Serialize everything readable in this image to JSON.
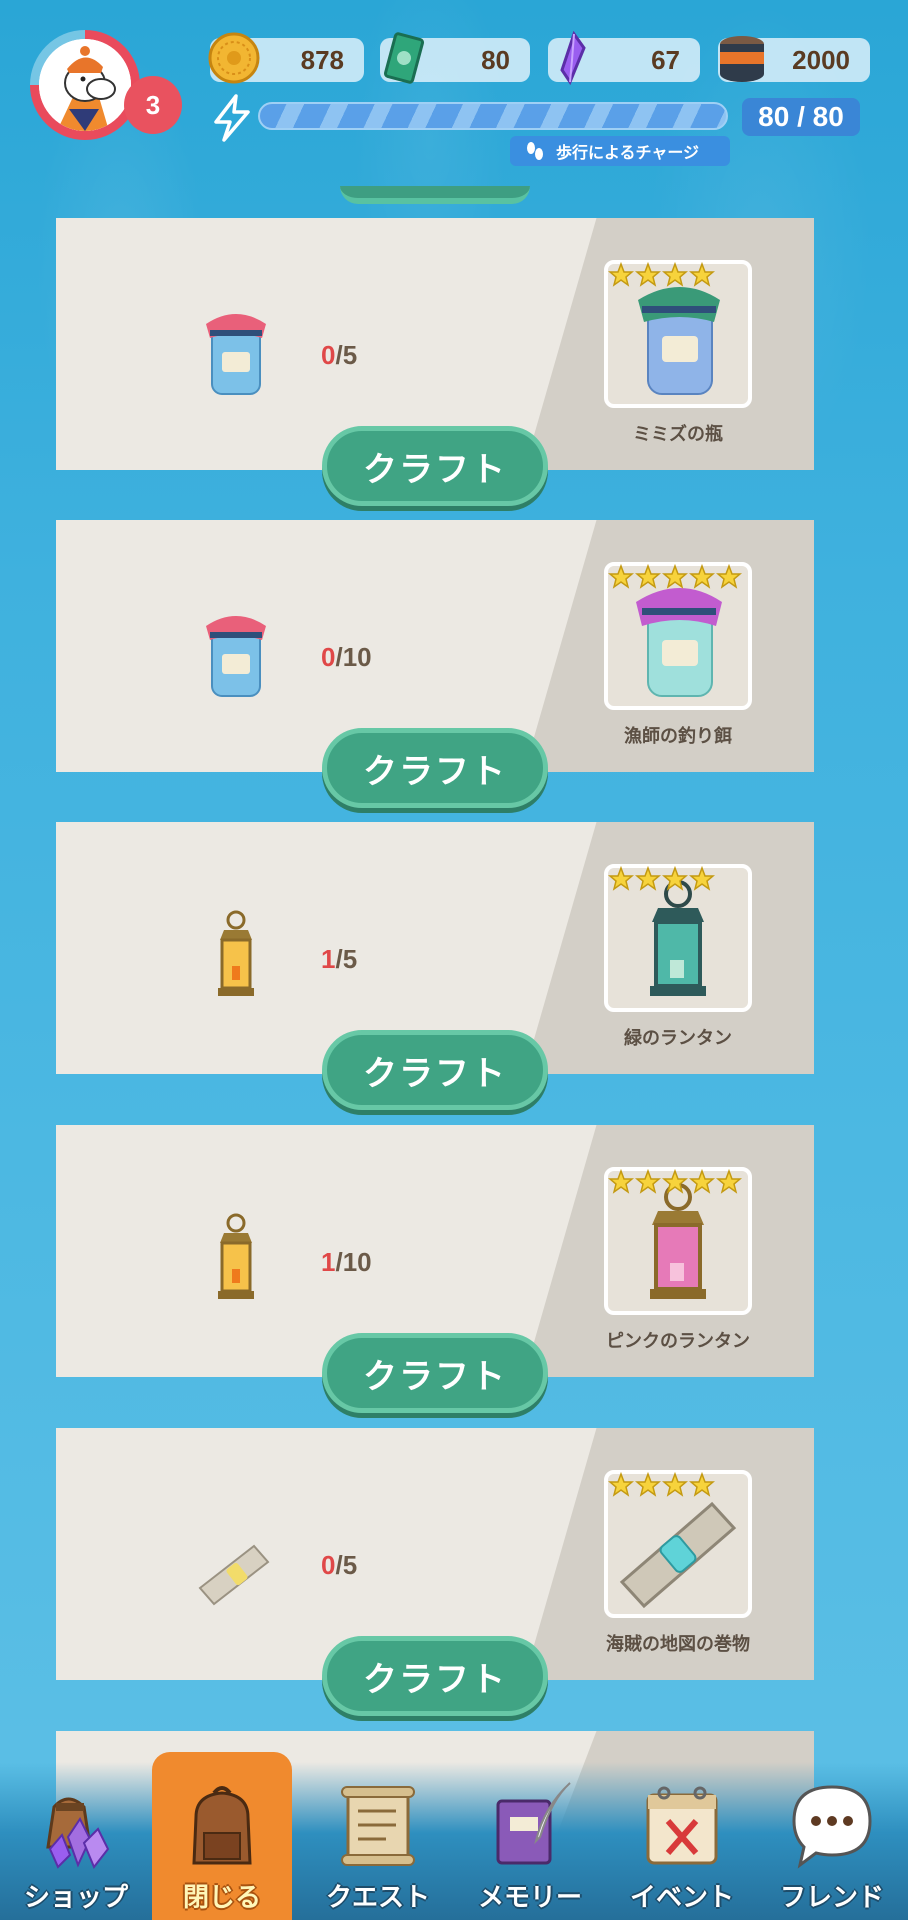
{
  "header": {
    "level": "3",
    "currencies": [
      {
        "name": "coin-icon",
        "value": "878"
      },
      {
        "name": "ticket-icon",
        "value": "80"
      },
      {
        "name": "crystal-icon",
        "value": "67"
      },
      {
        "name": "tin-can-icon",
        "value": "2000"
      }
    ],
    "energy": {
      "current_max": "80 / 80",
      "fill_fraction": 1.0
    },
    "walk_charge_label": "歩行によるチャージ"
  },
  "recipes": [
    {
      "material_icon": "pink-jar-icon",
      "have": "0",
      "need": "/5",
      "stars": 4,
      "result_icon": "green-jar-icon",
      "result_name": "ミミズの瓶",
      "button": "クラフト"
    },
    {
      "material_icon": "pink-jar-icon",
      "have": "0",
      "need": "/10",
      "stars": 5,
      "result_icon": "purple-jar-icon",
      "result_name": "漁師の釣り餌",
      "button": "クラフト"
    },
    {
      "material_icon": "yellow-lantern-icon",
      "have": "1",
      "need": "/5",
      "stars": 4,
      "result_icon": "green-lantern-icon",
      "result_name": "緑のランタン",
      "button": "クラフト"
    },
    {
      "material_icon": "yellow-lantern-icon",
      "have": "1",
      "need": "/10",
      "stars": 5,
      "result_icon": "pink-lantern-icon",
      "result_name": "ピンクのランタン",
      "button": "クラフト"
    },
    {
      "material_icon": "scroll-icon",
      "have": "0",
      "need": "/5",
      "stars": 4,
      "result_icon": "pirate-map-scroll-icon",
      "result_name": "海賊の地図の巻物",
      "button": "クラフト"
    }
  ],
  "nav": [
    {
      "name": "shop",
      "icon": "sack-crystals-icon",
      "label": "ショップ",
      "active": false
    },
    {
      "name": "close",
      "icon": "backpack-icon",
      "label": "閉じる",
      "active": true
    },
    {
      "name": "quest",
      "icon": "scroll-icon",
      "label": "クエスト",
      "active": false
    },
    {
      "name": "memory",
      "icon": "book-quill-icon",
      "label": "メモリー",
      "active": false
    },
    {
      "name": "event",
      "icon": "calendar-icon",
      "label": "イベント",
      "active": false
    },
    {
      "name": "friend",
      "icon": "speech-bubble-icon",
      "label": "フレンド",
      "active": false
    }
  ],
  "colors": {
    "accent_green": "#40a484",
    "nav_active": "#f08a2e",
    "shortfall_red": "#e04848"
  }
}
